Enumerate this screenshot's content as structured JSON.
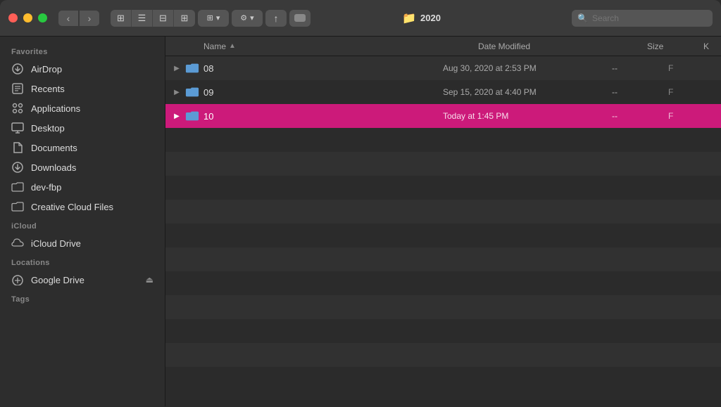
{
  "titlebar": {
    "title": "2020",
    "back_label": "‹",
    "forward_label": "›"
  },
  "toolbar": {
    "view_icon": "⊞",
    "list_icon": "☰",
    "column_icon": "⊟",
    "gallery_icon": "⊞",
    "arrange_label": "⊞",
    "action_label": "⚙",
    "action_arrow": "▾",
    "share_label": "↑",
    "tag_label": "⬜",
    "search_placeholder": "Search"
  },
  "sidebar": {
    "favorites_label": "Favorites",
    "icloud_label": "iCloud",
    "locations_label": "Locations",
    "tags_label": "Tags",
    "items": [
      {
        "id": "airdrop",
        "label": "AirDrop",
        "icon": "📡"
      },
      {
        "id": "recents",
        "label": "Recents",
        "icon": "🕐"
      },
      {
        "id": "applications",
        "label": "Applications",
        "icon": "🧩"
      },
      {
        "id": "desktop",
        "label": "Desktop",
        "icon": "🖥"
      },
      {
        "id": "documents",
        "label": "Documents",
        "icon": "📄"
      },
      {
        "id": "downloads",
        "label": "Downloads",
        "icon": "⬇"
      },
      {
        "id": "dev-fbp",
        "label": "dev-fbp",
        "icon": "📁"
      },
      {
        "id": "creative-cloud",
        "label": "Creative Cloud Files",
        "icon": "📁"
      }
    ],
    "icloud_items": [
      {
        "id": "icloud-drive",
        "label": "iCloud Drive",
        "icon": "☁"
      }
    ],
    "location_items": [
      {
        "id": "google-drive",
        "label": "Google Drive",
        "icon": "💿",
        "eject": true
      }
    ]
  },
  "columns": {
    "name": "Name",
    "date_modified": "Date Modified",
    "size": "Size",
    "kind": "K"
  },
  "files": [
    {
      "id": "08",
      "name": "08",
      "date": "Aug 30, 2020 at 2:53 PM",
      "size": "--",
      "kind": "F",
      "selected": false
    },
    {
      "id": "09",
      "name": "09",
      "date": "Sep 15, 2020 at 4:40 PM",
      "size": "--",
      "kind": "F",
      "selected": false
    },
    {
      "id": "10",
      "name": "10",
      "date": "Today at 1:45 PM",
      "size": "--",
      "kind": "F",
      "selected": true
    }
  ],
  "colors": {
    "selected_row": "#cc1a7a",
    "folder_blue": "#5b9bd5",
    "sidebar_bg": "#2d2d2d",
    "main_bg": "#2b2b2b"
  }
}
